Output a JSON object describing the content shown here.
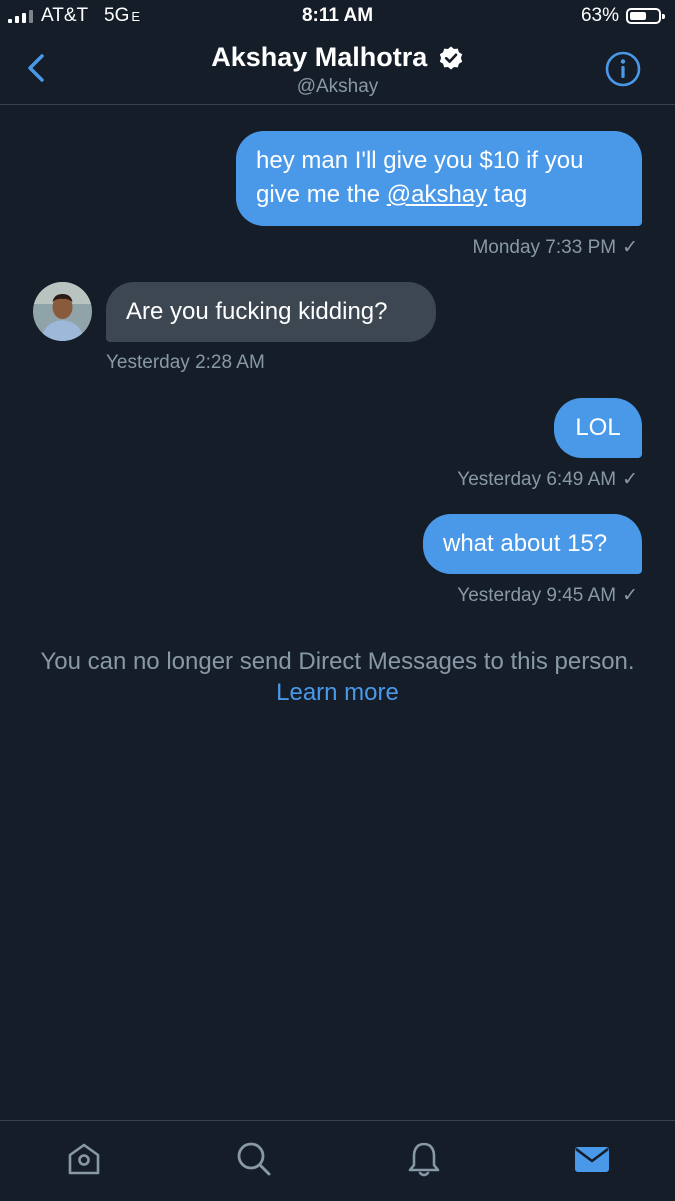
{
  "status_bar": {
    "carrier": "AT&T",
    "network": "5G",
    "network_suffix": "E",
    "time": "8:11 AM",
    "battery_percent": "63%",
    "battery_level": 0.63
  },
  "header": {
    "name": "Akshay Malhotra",
    "handle": "@Akshay",
    "verified": true,
    "back_icon": "chevron-left-icon",
    "info_icon": "info-icon"
  },
  "messages": [
    {
      "direction": "out",
      "text_before": "hey man I'll give you $10 if you give me the ",
      "mention": "@akshay",
      "text_after": " tag",
      "time": "Monday 7:33 PM",
      "status": "✓"
    },
    {
      "direction": "in",
      "text": "Are you fucking kidding?",
      "time": "Yesterday 2:28 AM"
    },
    {
      "direction": "out",
      "text": "LOL",
      "time": "Yesterday 6:49 AM",
      "status": "✓"
    },
    {
      "direction": "out",
      "text": "what about 15?",
      "time": "Yesterday 9:45 AM",
      "status": "✓"
    }
  ],
  "notice": {
    "text": "You can no longer send Direct Messages to this person.",
    "link": "Learn more"
  },
  "tabs": [
    {
      "name": "home-icon",
      "active": false
    },
    {
      "name": "search-icon",
      "active": false
    },
    {
      "name": "bell-icon",
      "active": false
    },
    {
      "name": "mail-icon",
      "active": true
    }
  ],
  "colors": {
    "background": "#151d28",
    "accent": "#4a99e9",
    "incoming_bubble": "#3d4752",
    "muted_text": "#8899a6"
  }
}
